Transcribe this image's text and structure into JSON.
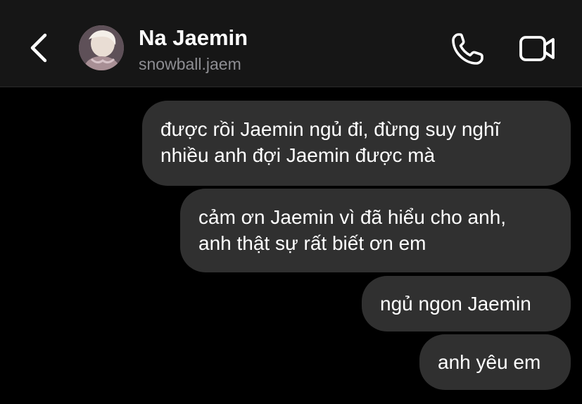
{
  "header": {
    "contact_name": "Na Jaemin",
    "contact_handle": "snowball.jaem",
    "icons": {
      "back": "chevron-left-icon",
      "call": "phone-icon",
      "video": "video-camera-icon"
    }
  },
  "messages": [
    {
      "from": "me",
      "lines": [
        "được rồi Jaemin ngủ đi, đừng suy nghĩ",
        "nhiều anh đợi Jaemin được mà"
      ]
    },
    {
      "from": "me",
      "lines": [
        "cảm ơn Jaemin vì đã hiểu cho anh,",
        "anh thật sự rất biết ơn em"
      ]
    },
    {
      "from": "me",
      "lines": [
        "ngủ ngon Jaemin"
      ]
    },
    {
      "from": "me",
      "lines": [
        "anh yêu em"
      ]
    }
  ],
  "colors": {
    "background": "#000000",
    "header_background": "#161616",
    "bubble_background": "#303030",
    "handle_text": "#8e8e93"
  }
}
